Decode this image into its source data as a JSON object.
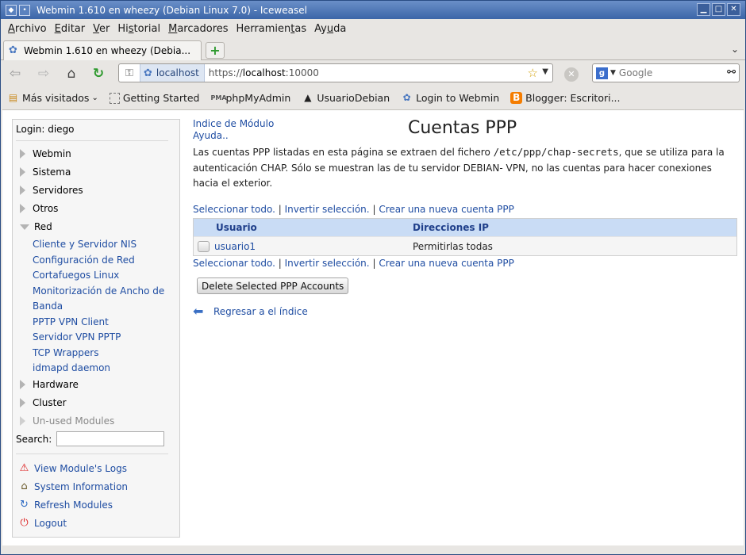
{
  "window": {
    "title": "Webmin 1.610 en wheezy (Debian Linux 7.0) - Iceweasel"
  },
  "menubar": {
    "items": [
      {
        "pre": "",
        "ul": "A",
        "post": "rchivo"
      },
      {
        "pre": "",
        "ul": "E",
        "post": "ditar"
      },
      {
        "pre": "",
        "ul": "V",
        "post": "er"
      },
      {
        "pre": "Hi",
        "ul": "s",
        "post": "torial"
      },
      {
        "pre": "",
        "ul": "M",
        "post": "arcadores"
      },
      {
        "pre": "Herramien",
        "ul": "t",
        "post": "as"
      },
      {
        "pre": "Ay",
        "ul": "u",
        "post": "da"
      }
    ]
  },
  "tab": {
    "label": "Webmin 1.610 en wheezy (Debia...",
    "new_tab": "+"
  },
  "urlbar": {
    "site": "localhost",
    "scheme": "https://",
    "host": "localhost",
    "port": ":10000"
  },
  "searchbar": {
    "placeholder": "Google"
  },
  "bookmarks": [
    {
      "label": "Más visitados",
      "icon": "folder-icon"
    },
    {
      "label": "Getting Started",
      "icon": "page-icon"
    },
    {
      "label": "phpMyAdmin",
      "icon": "pma-icon"
    },
    {
      "label": "UsuarioDebian",
      "icon": "tux-icon"
    },
    {
      "label": "Login to Webmin",
      "icon": "webmin-icon"
    },
    {
      "label": "Blogger: Escritori...",
      "icon": "blogger-icon"
    }
  ],
  "sidebar": {
    "login": "Login: diego",
    "categories": [
      "Webmin",
      "Sistema",
      "Servidores",
      "Otros",
      "Red"
    ],
    "red_items": [
      "Cliente y Servidor NIS",
      "Configuración de Red",
      "Cortafuegos Linux",
      "Monitorización de Ancho de",
      "Banda",
      "PPTP VPN Client",
      "Servidor VPN PPTP",
      "TCP Wrappers",
      "idmapd daemon"
    ],
    "categories_after": [
      "Hardware",
      "Cluster",
      "Un-used Modules"
    ],
    "search_label": "Search:",
    "links": [
      {
        "label": "View Module's Logs",
        "icon": "warning-icon"
      },
      {
        "label": "System Information",
        "icon": "home-icon"
      },
      {
        "label": "Refresh Modules",
        "icon": "refresh-icon"
      },
      {
        "label": "Logout",
        "icon": "power-icon"
      }
    ]
  },
  "main": {
    "index_link": "Indice de Módulo",
    "help_link": "Ayuda..",
    "title": "Cuentas PPP",
    "desc_1": "Las cuentas PPP listadas en esta página se extraen del fichero ",
    "desc_path": "/etc/ppp/chap-secrets",
    "desc_2": ", que se utiliza para la autenticación CHAP. Sólo se muestran las de tu servidor DEBIAN- VPN, no las cuentas para hacer conexiones hacia el exterior.",
    "select_all": "Seleccionar todo.",
    "invert": "Invertir selección.",
    "create": "Crear una nueva cuenta PPP",
    "sep": "|",
    "table": {
      "headers": [
        "Usuario",
        "Direcciones IP"
      ],
      "rows": [
        {
          "user": "usuario1",
          "ips": "Permitirlas todas"
        }
      ]
    },
    "delete_button": "Delete Selected PPP Accounts",
    "back_link": "Regresar a el índice"
  }
}
